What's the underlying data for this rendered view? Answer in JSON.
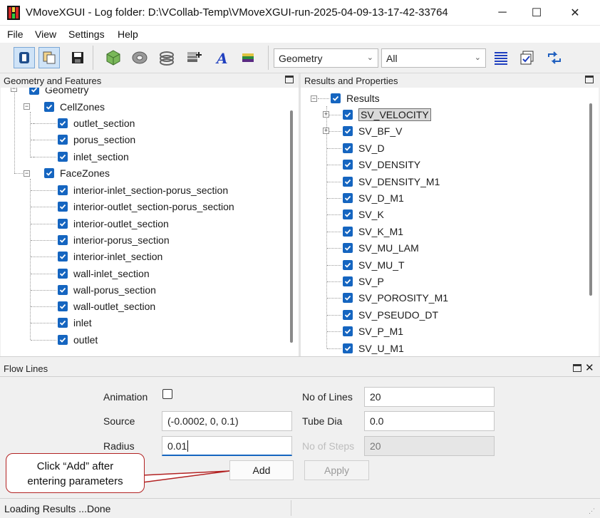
{
  "window": {
    "title": "VMoveXGUI - Log folder: D:\\VCollab-Temp\\VMoveXGUI-run-2025-04-09-13-17-42-33764",
    "minimize": "─",
    "maximize": "☐",
    "close": "✕"
  },
  "menu": {
    "file": "File",
    "view": "View",
    "settings": "Settings",
    "help": "Help"
  },
  "toolbar": {
    "geometry_select": "Geometry",
    "filter_select": "All"
  },
  "left_panel": {
    "title": "Geometry and Features",
    "root": "Geometry",
    "cellzones": {
      "label": "CellZones",
      "items": [
        "outlet_section",
        "porus_section",
        "inlet_section"
      ]
    },
    "facezones": {
      "label": "FaceZones",
      "items": [
        "interior-inlet_section-porus_section",
        "interior-outlet_section-porus_section",
        "interior-outlet_section",
        "interior-porus_section",
        "interior-inlet_section",
        "wall-inlet_section",
        "wall-porus_section",
        "wall-outlet_section",
        "inlet",
        "outlet"
      ]
    }
  },
  "right_panel": {
    "title": "Results and Properties",
    "root": "Results",
    "items": [
      "SV_VELOCITY",
      "SV_BF_V",
      "SV_D",
      "SV_DENSITY",
      "SV_DENSITY_M1",
      "SV_D_M1",
      "SV_K",
      "SV_K_M1",
      "SV_MU_LAM",
      "SV_MU_T",
      "SV_P",
      "SV_POROSITY_M1",
      "SV_PSEUDO_DT",
      "SV_P_M1",
      "SV_U_M1"
    ]
  },
  "flow_lines": {
    "title": "Flow Lines",
    "animation_label": "Animation",
    "source_label": "Source",
    "source_value": "(-0.0002, 0, 0.1)",
    "radius_label": "Radius",
    "radius_value": "0.01",
    "lines_label": "No of Lines",
    "lines_value": "20",
    "tube_label": "Tube Dia",
    "tube_value": "0.0",
    "steps_label": "No of Steps",
    "steps_value": "20",
    "add_label": "Add",
    "apply_label": "Apply"
  },
  "callout": {
    "line1": "Click “Add” after",
    "line2": "entering parameters"
  },
  "status": {
    "text": "Loading Results ...Done"
  },
  "colors": {
    "checkbox": "#1565c0",
    "callout_border": "#b22222"
  }
}
